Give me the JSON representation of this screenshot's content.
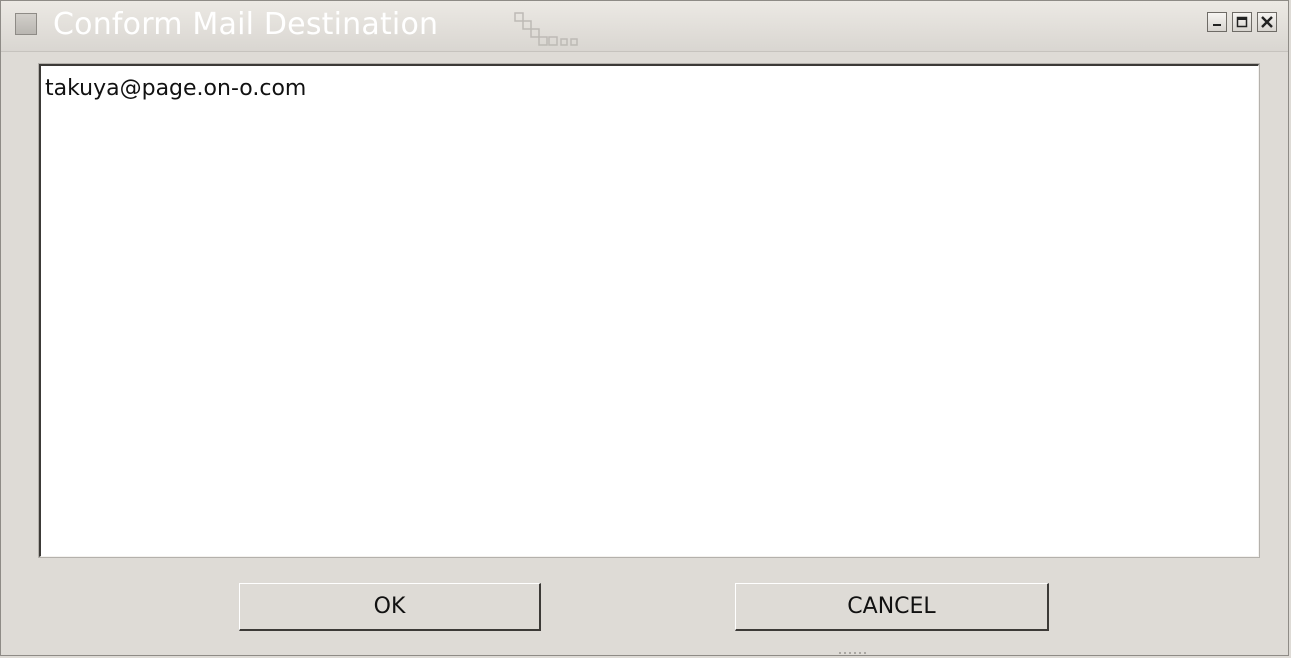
{
  "window": {
    "title": "Conform Mail Destination"
  },
  "controls": {
    "menu_icon": "window-menu-icon",
    "minimize_icon": "minimize-icon",
    "maximize_icon": "maximize-icon",
    "close_icon": "close-icon"
  },
  "destination": {
    "text": "takuya@page.on-o.com"
  },
  "buttons": {
    "ok_label": "OK",
    "cancel_label": "CANCEL"
  },
  "colors": {
    "background": "#dedbd6",
    "title_text": "#ffffff",
    "text_area_bg": "#ffffff"
  }
}
